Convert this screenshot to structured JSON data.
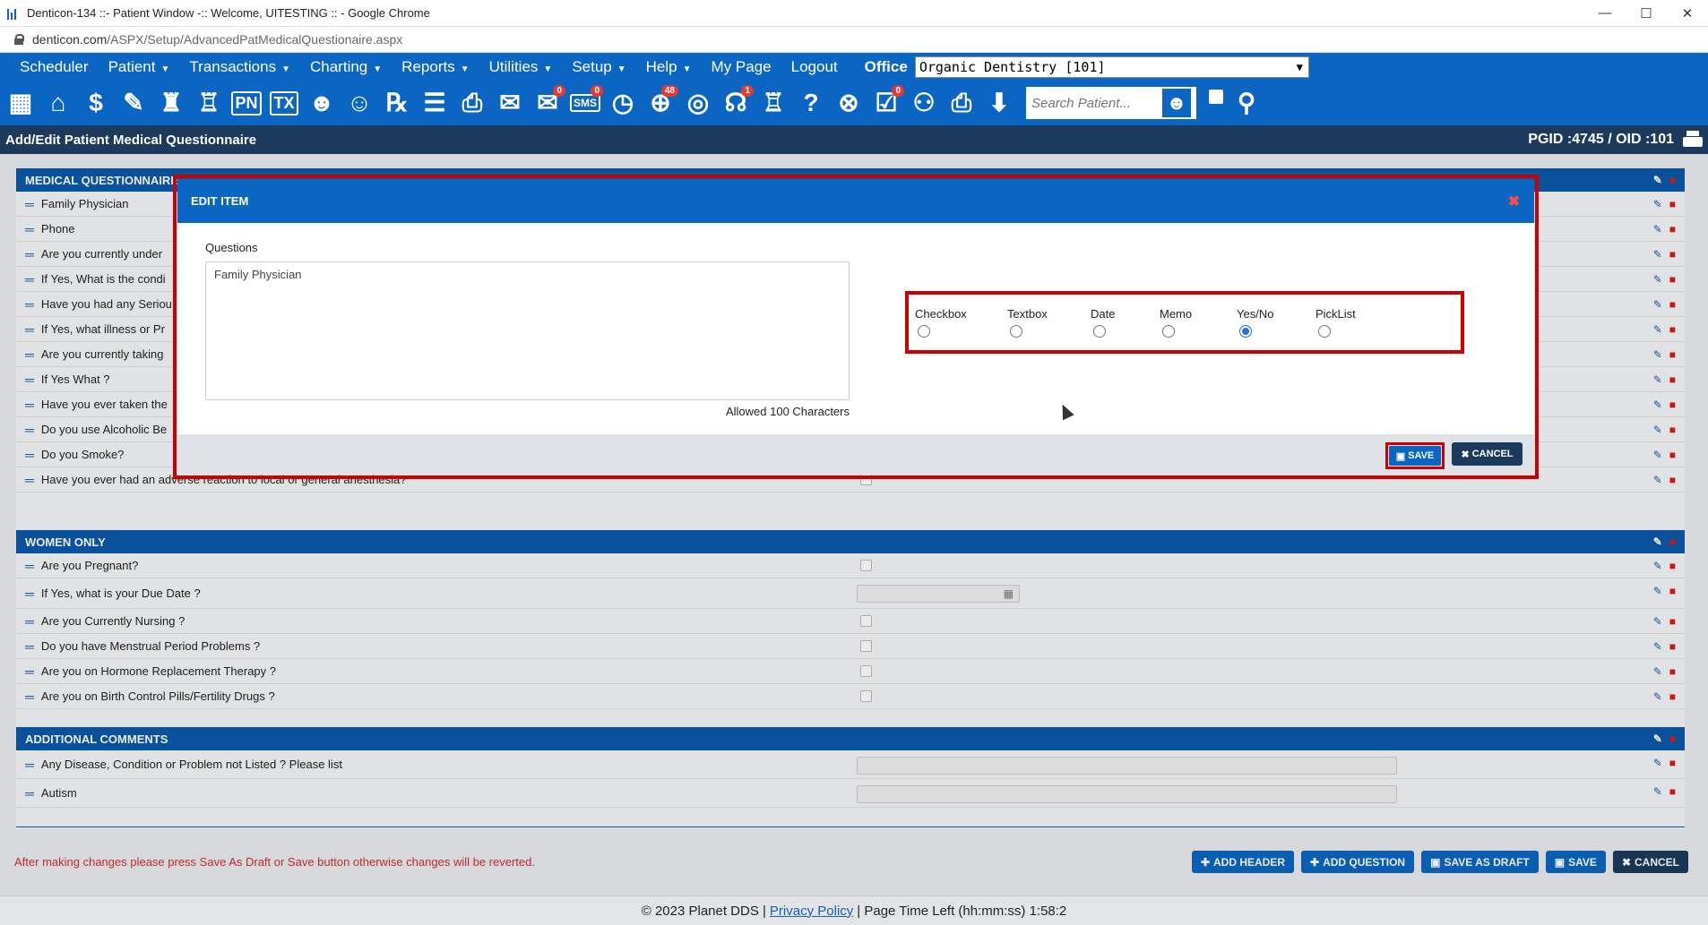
{
  "window": {
    "title": "Denticon-134 ::- Patient Window -:: Welcome, UITESTING :: - Google Chrome"
  },
  "address": {
    "domain": "denticon.com",
    "path": "/ASPX/Setup/AdvancedPatMedicalQuestionaire.aspx"
  },
  "nav": {
    "items": [
      "Scheduler",
      "Patient",
      "Transactions",
      "Charting",
      "Reports",
      "Utilities",
      "Setup",
      "Help",
      "My Page",
      "Logout"
    ],
    "office_label": "Office",
    "office_value": "Organic Dentistry [101]"
  },
  "toolbar": {
    "icons": [
      "calendar-icon",
      "home-icon",
      "dollar-icon",
      "pen-icon",
      "tooth-icon",
      "tooth-roots-icon",
      "pn-icon",
      "tx-icon",
      "patient-add-icon",
      "patient-plus-icon",
      "rx-icon",
      "notes-icon",
      "print-doc-icon",
      "mail-icon",
      "chat-icon",
      "sms-icon",
      "clock-icon",
      "globe-users-icon",
      "support-icon",
      "headset-icon",
      "tooth-outline-icon",
      "tooth-help-icon",
      "globe-icon",
      "doc-check-icon",
      "family-icon",
      "printer-icon",
      "download-icon"
    ],
    "pn": "PN",
    "tx": "TX",
    "sms": "SMS",
    "badge_chat": "0",
    "badge_sms": "0",
    "badge_globe": "48",
    "badge_headset": "1",
    "badge_doc": "0",
    "search_placeholder": "Search Patient..."
  },
  "page": {
    "title": "Add/Edit Patient Medical Questionnaire",
    "ids": "PGID :4745  /  OID :101"
  },
  "sections": {
    "medical": {
      "header": "MEDICAL QUESTIONNAIRE",
      "rows": [
        "Family Physician",
        "Phone",
        "Are you currently under",
        "If Yes, What is the condi",
        "Have you had any Seriou",
        "If Yes, what illness or Pr",
        "Are you currently taking",
        "If Yes What ?",
        "Have you ever taken the",
        "Do you use Alcoholic Be",
        "Do you Smoke?",
        "Have you ever had an adverse reaction to local or general anesthesia?"
      ]
    },
    "women": {
      "header": "WOMEN ONLY",
      "rows": [
        "Are you Pregnant?",
        "If Yes, what is your Due Date ?",
        "Are you Currently Nursing ?",
        "Do you have Menstrual Period Problems ?",
        "Are you on Hormone Replacement Therapy ?",
        "Are you on Birth Control Pills/Fertility Drugs ?"
      ]
    },
    "comments": {
      "header": "ADDITIONAL COMMENTS",
      "rows": [
        "Any Disease, Condition or Problem not Listed ? Please list",
        "Autism"
      ]
    }
  },
  "bottom": {
    "warning": "After making changes please press Save As Draft or Save button otherwise changes will be reverted.",
    "buttons": [
      "ADD HEADER",
      "ADD QUESTION",
      "SAVE AS DRAFT",
      "SAVE",
      "CANCEL"
    ]
  },
  "footer": {
    "copyright": "© 2023 Planet DDS |",
    "privacy": "Privacy Policy",
    "timeleft": "|  Page Time Left (hh:mm:ss) 1:58:2"
  },
  "modal": {
    "title": "EDIT ITEM",
    "questions_label": "Questions",
    "question_value": "Family Physician",
    "allowed": "Allowed 100 Characters",
    "types": [
      "Checkbox",
      "Textbox",
      "Date",
      "Memo",
      "Yes/No",
      "PickList"
    ],
    "selected_type": "Yes/No",
    "save": "SAVE",
    "cancel": "CANCEL"
  }
}
